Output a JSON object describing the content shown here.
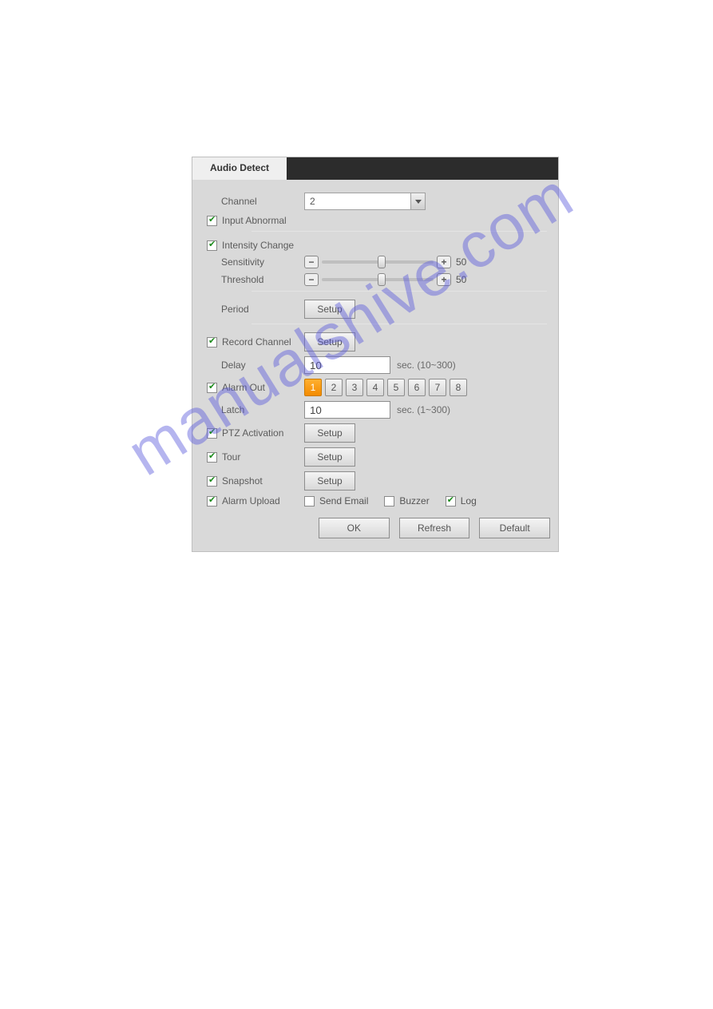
{
  "tab": {
    "title": "Audio Detect"
  },
  "channel": {
    "label": "Channel",
    "value": "2"
  },
  "input_abnormal": {
    "label": "Input Abnormal",
    "checked": true
  },
  "intensity_change": {
    "label": "Intensity Change",
    "checked": true
  },
  "sensitivity": {
    "label": "Sensitivity",
    "value": 50,
    "min": 0,
    "max": 100
  },
  "threshold": {
    "label": "Threshold",
    "value": 50,
    "min": 0,
    "max": 100
  },
  "period": {
    "label": "Period",
    "button": "Setup"
  },
  "record_channel": {
    "label": "Record Channel",
    "checked": true,
    "button": "Setup"
  },
  "delay": {
    "label": "Delay",
    "value": "10",
    "hint": "sec. (10~300)"
  },
  "alarm_out": {
    "label": "Alarm Out",
    "checked": true,
    "buttons": [
      "1",
      "2",
      "3",
      "4",
      "5",
      "6",
      "7",
      "8"
    ],
    "selected": [
      "1"
    ]
  },
  "latch": {
    "label": "Latch",
    "value": "10",
    "hint": "sec. (1~300)"
  },
  "ptz_activation": {
    "label": "PTZ Activation",
    "checked": true,
    "button": "Setup"
  },
  "tour": {
    "label": "Tour",
    "checked": true,
    "button": "Setup"
  },
  "snapshot": {
    "label": "Snapshot",
    "checked": true,
    "button": "Setup"
  },
  "alarm_upload": {
    "label": "Alarm Upload",
    "checked": true
  },
  "options": {
    "send_email": {
      "label": "Send Email",
      "checked": false
    },
    "buzzer": {
      "label": "Buzzer",
      "checked": false
    },
    "log": {
      "label": "Log",
      "checked": true
    }
  },
  "footer": {
    "ok": "OK",
    "refresh": "Refresh",
    "default": "Default"
  },
  "watermark": "manualshive.com"
}
